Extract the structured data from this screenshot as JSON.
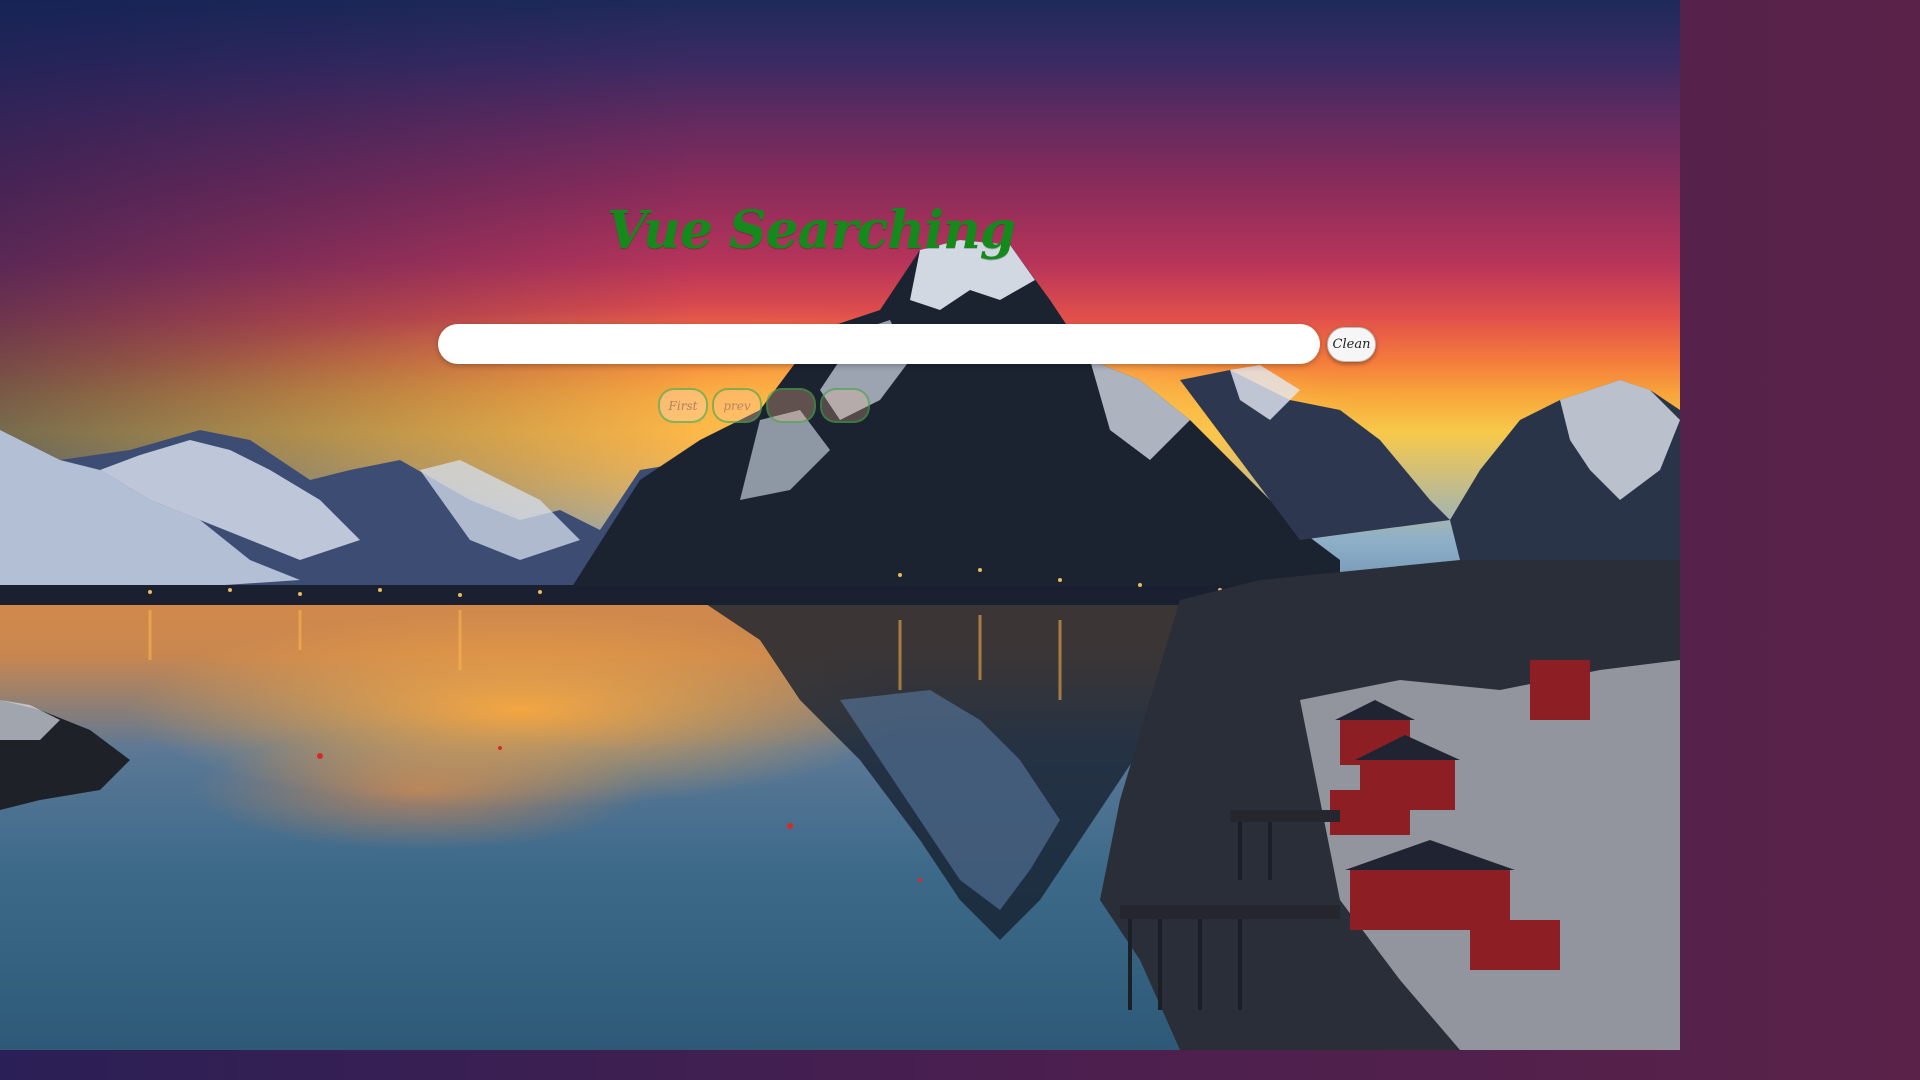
{
  "app": {
    "title": "Vue Searching",
    "title_color": "#15891b"
  },
  "search": {
    "value": "",
    "placeholder": "",
    "clean_label": "Clean"
  },
  "pagination": {
    "items": [
      "First",
      "prev",
      "",
      ""
    ]
  }
}
